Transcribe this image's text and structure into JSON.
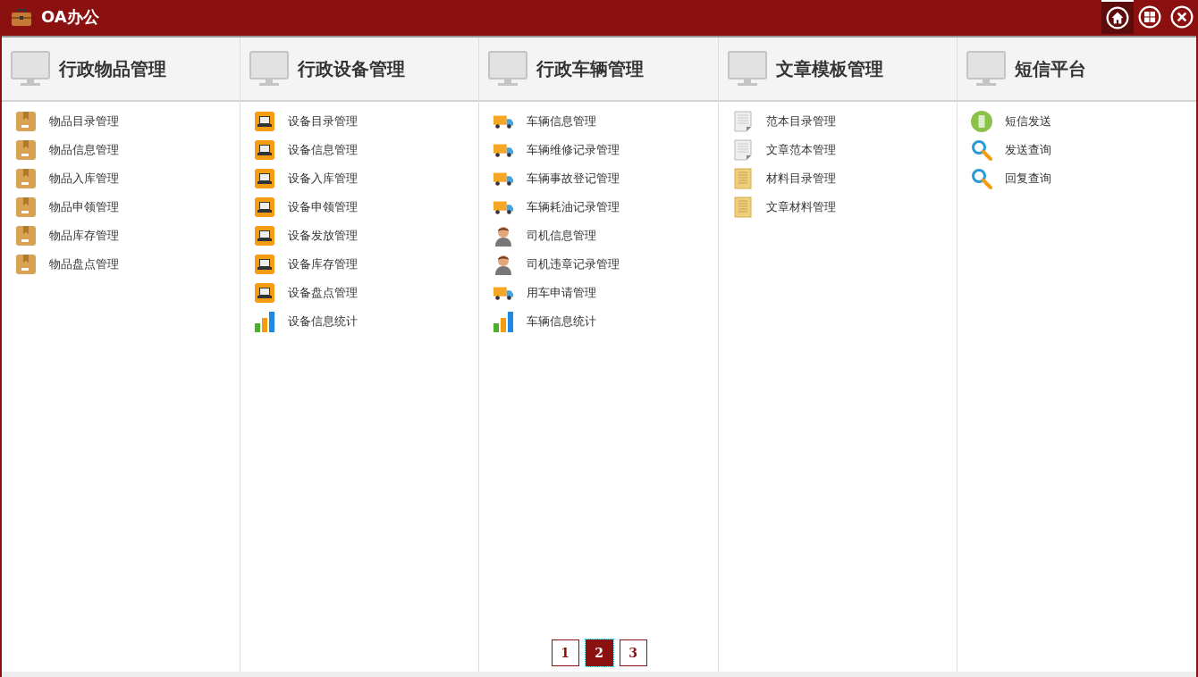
{
  "window": {
    "title": "OA办公"
  },
  "title_buttons": [
    {
      "kind": "home",
      "selected": true
    },
    {
      "kind": "grid",
      "selected": false
    },
    {
      "kind": "close",
      "selected": false
    }
  ],
  "columns": [
    {
      "title": "行政物品管理",
      "items": [
        {
          "kind": "box",
          "label": "物品目录管理"
        },
        {
          "kind": "box",
          "label": "物品信息管理"
        },
        {
          "kind": "box",
          "label": "物品入库管理"
        },
        {
          "kind": "box",
          "label": "物品申领管理"
        },
        {
          "kind": "box",
          "label": "物品库存管理"
        },
        {
          "kind": "box",
          "label": "物品盘点管理"
        }
      ]
    },
    {
      "title": "行政设备管理",
      "items": [
        {
          "kind": "laptop",
          "label": "设备目录管理"
        },
        {
          "kind": "laptop",
          "label": "设备信息管理"
        },
        {
          "kind": "laptop",
          "label": "设备入库管理"
        },
        {
          "kind": "laptop",
          "label": "设备申领管理"
        },
        {
          "kind": "laptop",
          "label": "设备发放管理"
        },
        {
          "kind": "laptop",
          "label": "设备库存管理"
        },
        {
          "kind": "laptop",
          "label": "设备盘点管理"
        },
        {
          "kind": "chart",
          "label": "设备信息统计"
        }
      ]
    },
    {
      "title": "行政车辆管理",
      "items": [
        {
          "kind": "truck",
          "label": "车辆信息管理"
        },
        {
          "kind": "truck",
          "label": "车辆维修记录管理"
        },
        {
          "kind": "truck",
          "label": "车辆事故登记管理"
        },
        {
          "kind": "truck",
          "label": "车辆耗油记录管理"
        },
        {
          "kind": "person",
          "label": "司机信息管理"
        },
        {
          "kind": "person",
          "label": "司机违章记录管理"
        },
        {
          "kind": "truck",
          "label": "用车申请管理"
        },
        {
          "kind": "chart",
          "label": "车辆信息统计"
        }
      ]
    },
    {
      "title": "文章模板管理",
      "items": [
        {
          "kind": "doc",
          "label": "范本目录管理"
        },
        {
          "kind": "doc",
          "label": "文章范本管理"
        },
        {
          "kind": "notepad",
          "label": "材料目录管理"
        },
        {
          "kind": "notepad",
          "label": "文章材料管理"
        }
      ]
    },
    {
      "title": "短信平台",
      "items": [
        {
          "kind": "phone",
          "label": "短信发送"
        },
        {
          "kind": "search",
          "label": "发送查询"
        },
        {
          "kind": "search",
          "label": "回复查询"
        }
      ]
    }
  ],
  "pagination": [
    {
      "label": "1",
      "selected": false
    },
    {
      "label": "2",
      "selected": true
    },
    {
      "label": "3",
      "selected": false
    }
  ]
}
